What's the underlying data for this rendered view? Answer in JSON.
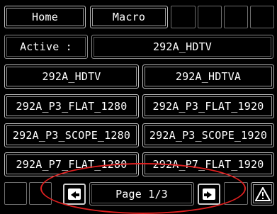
{
  "top_row": {
    "home_label": "Home",
    "macro_label": "Macro"
  },
  "active": {
    "label": "Active :",
    "value": "292A_HDTV"
  },
  "presets": [
    "292A_HDTV",
    "292A_HDTVA",
    "292A_P3_FLAT_1280",
    "292A_P3_FLAT_1920",
    "292A_P3_SCOPE_1280",
    "292A_P3_SCOPE_1920",
    "292A_P7_FLAT_1280",
    "292A_P7_FLAT_1920"
  ],
  "pager": {
    "page_label": "Page 1/3",
    "prev_icon": "arrow-left-icon",
    "next_icon": "arrow-right-icon"
  },
  "warning_icon": "warning-triangle-icon",
  "colors": {
    "background": "#000000",
    "text": "#ffffff",
    "border": "#8a8a8a",
    "annotation": "#e02020"
  }
}
